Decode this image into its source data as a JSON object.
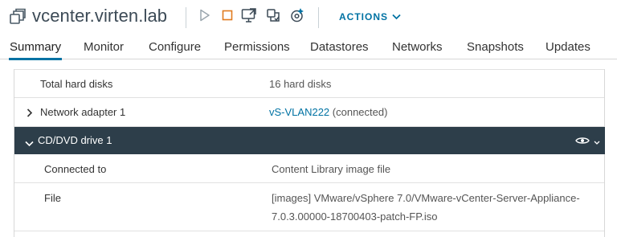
{
  "header": {
    "title": "vcenter.virten.lab",
    "actions_label": "ACTIONS",
    "toolbar_icons": [
      "vm-icon",
      "power-on-icon",
      "power-off-icon",
      "launch-console-icon",
      "migrate-icon",
      "snapshot-icon"
    ]
  },
  "tabs": [
    {
      "label": "Summary",
      "active": true
    },
    {
      "label": "Monitor"
    },
    {
      "label": "Configure"
    },
    {
      "label": "Permissions"
    },
    {
      "label": "Datastores"
    },
    {
      "label": "Networks"
    },
    {
      "label": "Snapshots"
    },
    {
      "label": "Updates"
    }
  ],
  "hardware": {
    "total_disks": {
      "label": "Total hard disks",
      "value": "16 hard disks"
    },
    "network_adapter": {
      "label": "Network adapter 1",
      "network": "vS-VLAN222",
      "state": "(connected)"
    },
    "cd_dvd": {
      "label": "CD/DVD drive 1",
      "connected_to_label": "Connected to",
      "connected_to_value": "Content Library image file",
      "file_label": "File",
      "file_value_line1": "[images] VMware/vSphere 7.0/VMware-vCenter-Server-Appliance-",
      "file_value_line2": "7.0.3.00000-18700403-patch-FP.iso"
    }
  },
  "colors": {
    "accent": "#0072a3",
    "selected_row": "#2d3e4a",
    "title_text": "#3c4a56"
  }
}
